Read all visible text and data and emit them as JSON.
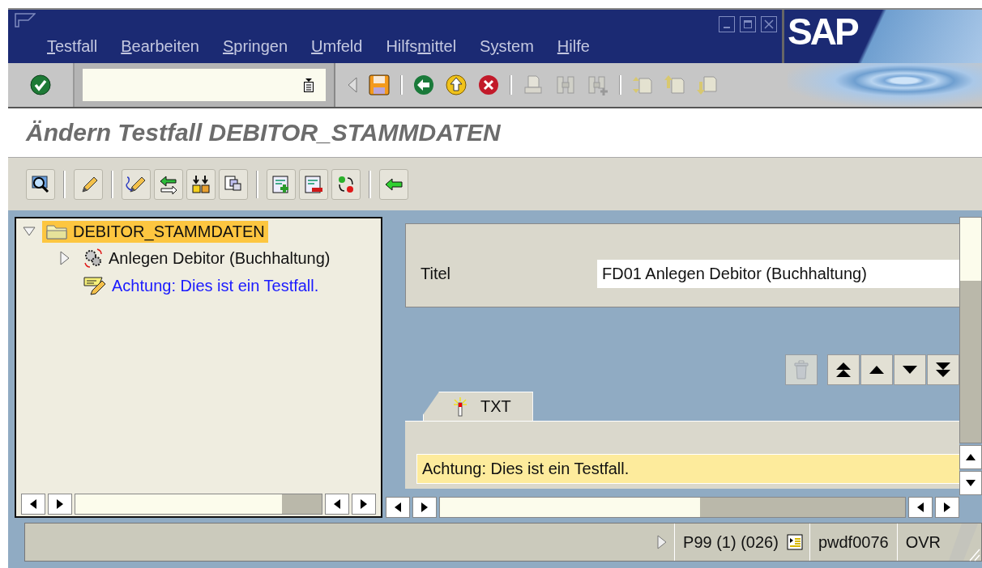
{
  "menu": [
    {
      "key": "T",
      "after": "estfall"
    },
    {
      "key": "B",
      "after": "earbeiten"
    },
    {
      "key": "S",
      "after": "pringen"
    },
    {
      "key": "U",
      "after": "mfeld"
    },
    {
      "before": "Hilfs",
      "key": "m",
      "after": "ittel"
    },
    {
      "before": "S",
      "key": "y",
      "after": "stem"
    },
    {
      "key": "H",
      "after": "ilfe"
    }
  ],
  "logo": "SAP",
  "title": "Ändern Testfall DEBITOR_STAMMDATEN",
  "tree": [
    {
      "label": "DEBITOR_STAMMDATEN",
      "kind": "folder",
      "selected": true,
      "expanded": true,
      "children": [
        {
          "label": "Anlegen Debitor (Buchhaltung)",
          "kind": "step",
          "selected": false,
          "expanded": false
        },
        {
          "label": "Achtung: Dies ist ein Testfall.",
          "kind": "note",
          "selected": false
        }
      ]
    }
  ],
  "detail": {
    "label": "Titel",
    "value": "FD01 Anlegen Debitor (Buchhaltung)"
  },
  "delete_button": {
    "disabled": true
  },
  "tabs": [
    {
      "label": "TXT",
      "selected": true
    }
  ],
  "text_field": {
    "value": "Achtung: Dies ist ein Testfall."
  },
  "status_bar": {
    "system": "P99 (1) (026)",
    "server": "pwdf0076",
    "mode": "OVR"
  }
}
